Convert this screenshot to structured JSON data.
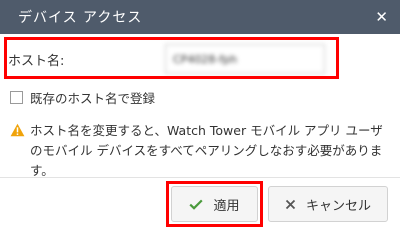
{
  "dialog": {
    "title": "デバイス アクセス",
    "close_icon": "close-icon"
  },
  "host_name": {
    "label": "ホスト名:",
    "value": "CP4028-fph"
  },
  "existing_host": {
    "label": "既存のホスト名で登録",
    "checked": false
  },
  "warning": {
    "icon": "warning-icon",
    "text": "ホスト名を変更すると、Watch Tower モバイル アプリ ユーザのモバイル デバイスをすべてペアリングしなおす必要があります。"
  },
  "buttons": {
    "apply_label": "適用",
    "apply_icon": "check-icon",
    "cancel_label": "キャンセル",
    "cancel_icon": "x-icon"
  },
  "colors": {
    "titlebar": "#4f5b6b",
    "highlight": "#ff0000",
    "check": "#4a9a3c",
    "warning": "#f0a30a"
  }
}
